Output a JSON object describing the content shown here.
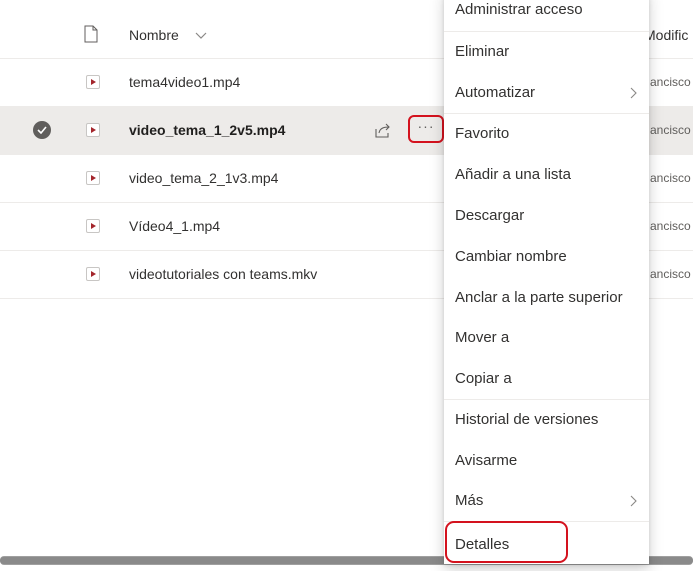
{
  "header": {
    "name_label": "Nombre",
    "modified_label": "Modific"
  },
  "files": [
    {
      "name": "tema4video1.mp4",
      "modified_by": "ancisco",
      "selected": false
    },
    {
      "name": "video_tema_1_2v5.mp4",
      "modified_by": "ancisco",
      "selected": true
    },
    {
      "name": "video_tema_2_1v3.mp4",
      "modified_by": "ancisco",
      "selected": false
    },
    {
      "name": "Vídeo4_1.mp4",
      "modified_by": "ancisco",
      "selected": false
    },
    {
      "name": "videotutoriales con teams.mkv",
      "modified_by": "ancisco",
      "selected": false
    }
  ],
  "row_actions": {
    "share_icon": "share-icon",
    "more_label": "···"
  },
  "context_menu": {
    "items": [
      {
        "label": "Administrar acceso"
      },
      {
        "label": "Eliminar"
      },
      {
        "label": "Automatizar",
        "submenu": true
      },
      {
        "label": "Favorito"
      },
      {
        "label": "Añadir a una lista"
      },
      {
        "label": "Descargar"
      },
      {
        "label": "Cambiar nombre"
      },
      {
        "label": "Anclar a la parte superior"
      },
      {
        "label": "Mover a"
      },
      {
        "label": "Copiar a"
      },
      {
        "label": "Historial de versiones"
      },
      {
        "label": "Avisarme"
      },
      {
        "label": "Más",
        "submenu": true
      },
      {
        "label": "Detalles"
      }
    ]
  },
  "colors": {
    "highlight_red": "#d4121e",
    "selected_row": "#edebe9",
    "video_icon": "#a4262c"
  }
}
